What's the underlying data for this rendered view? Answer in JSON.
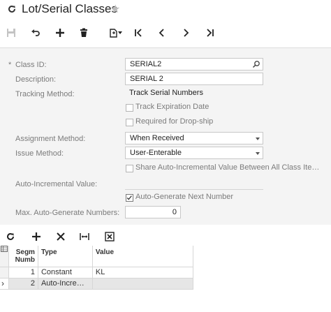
{
  "title_bar": {
    "title": "Lot/Serial Classes"
  },
  "form": {
    "class_id_label": "Class ID:",
    "required_mark": "*",
    "class_id_value": "SERIAL2",
    "description_label": "Description:",
    "description_value": "SERIAL 2",
    "tracking_method_label": "Tracking Method:",
    "tracking_method_value": "Track Serial Numbers",
    "track_expiration_label": "Track Expiration Date",
    "required_dropship_label": "Required for Drop-ship",
    "assignment_method_label": "Assignment Method:",
    "assignment_method_value": "When Received",
    "issue_method_label": "Issue Method:",
    "issue_method_value": "User-Enterable",
    "share_auto_incremental_label": "Share Auto-Incremental Value Between All Class Ite…",
    "auto_incremental_value_label": "Auto-Incremental Value:",
    "auto_generate_next_label": "Auto-Generate Next Number",
    "max_auto_generate_label": "Max. Auto-Generate Numbers:",
    "max_auto_generate_value": "0",
    "checkboxes": {
      "track_expiration": false,
      "required_dropship": false,
      "share_auto_incremental": false,
      "auto_generate_next": true
    }
  },
  "grid": {
    "headers": {
      "segment": "Segm\nNumb",
      "type": "Type",
      "value": "Value"
    },
    "rows": [
      {
        "segment": "1",
        "type": "Constant",
        "value": "KL"
      },
      {
        "segment": "2",
        "type": "Auto-Incre…",
        "value": ""
      }
    ]
  },
  "icons": {
    "toolbar": [
      "save-icon",
      "undo-icon",
      "add-icon",
      "delete-icon",
      "copy-paste-icon",
      "first-record-icon",
      "previous-record-icon",
      "next-record-icon",
      "last-record-icon"
    ],
    "grid_toolbar": [
      "refresh-icon",
      "add-row-icon",
      "delete-row-icon",
      "fit-columns-icon",
      "export-excel-icon"
    ]
  }
}
